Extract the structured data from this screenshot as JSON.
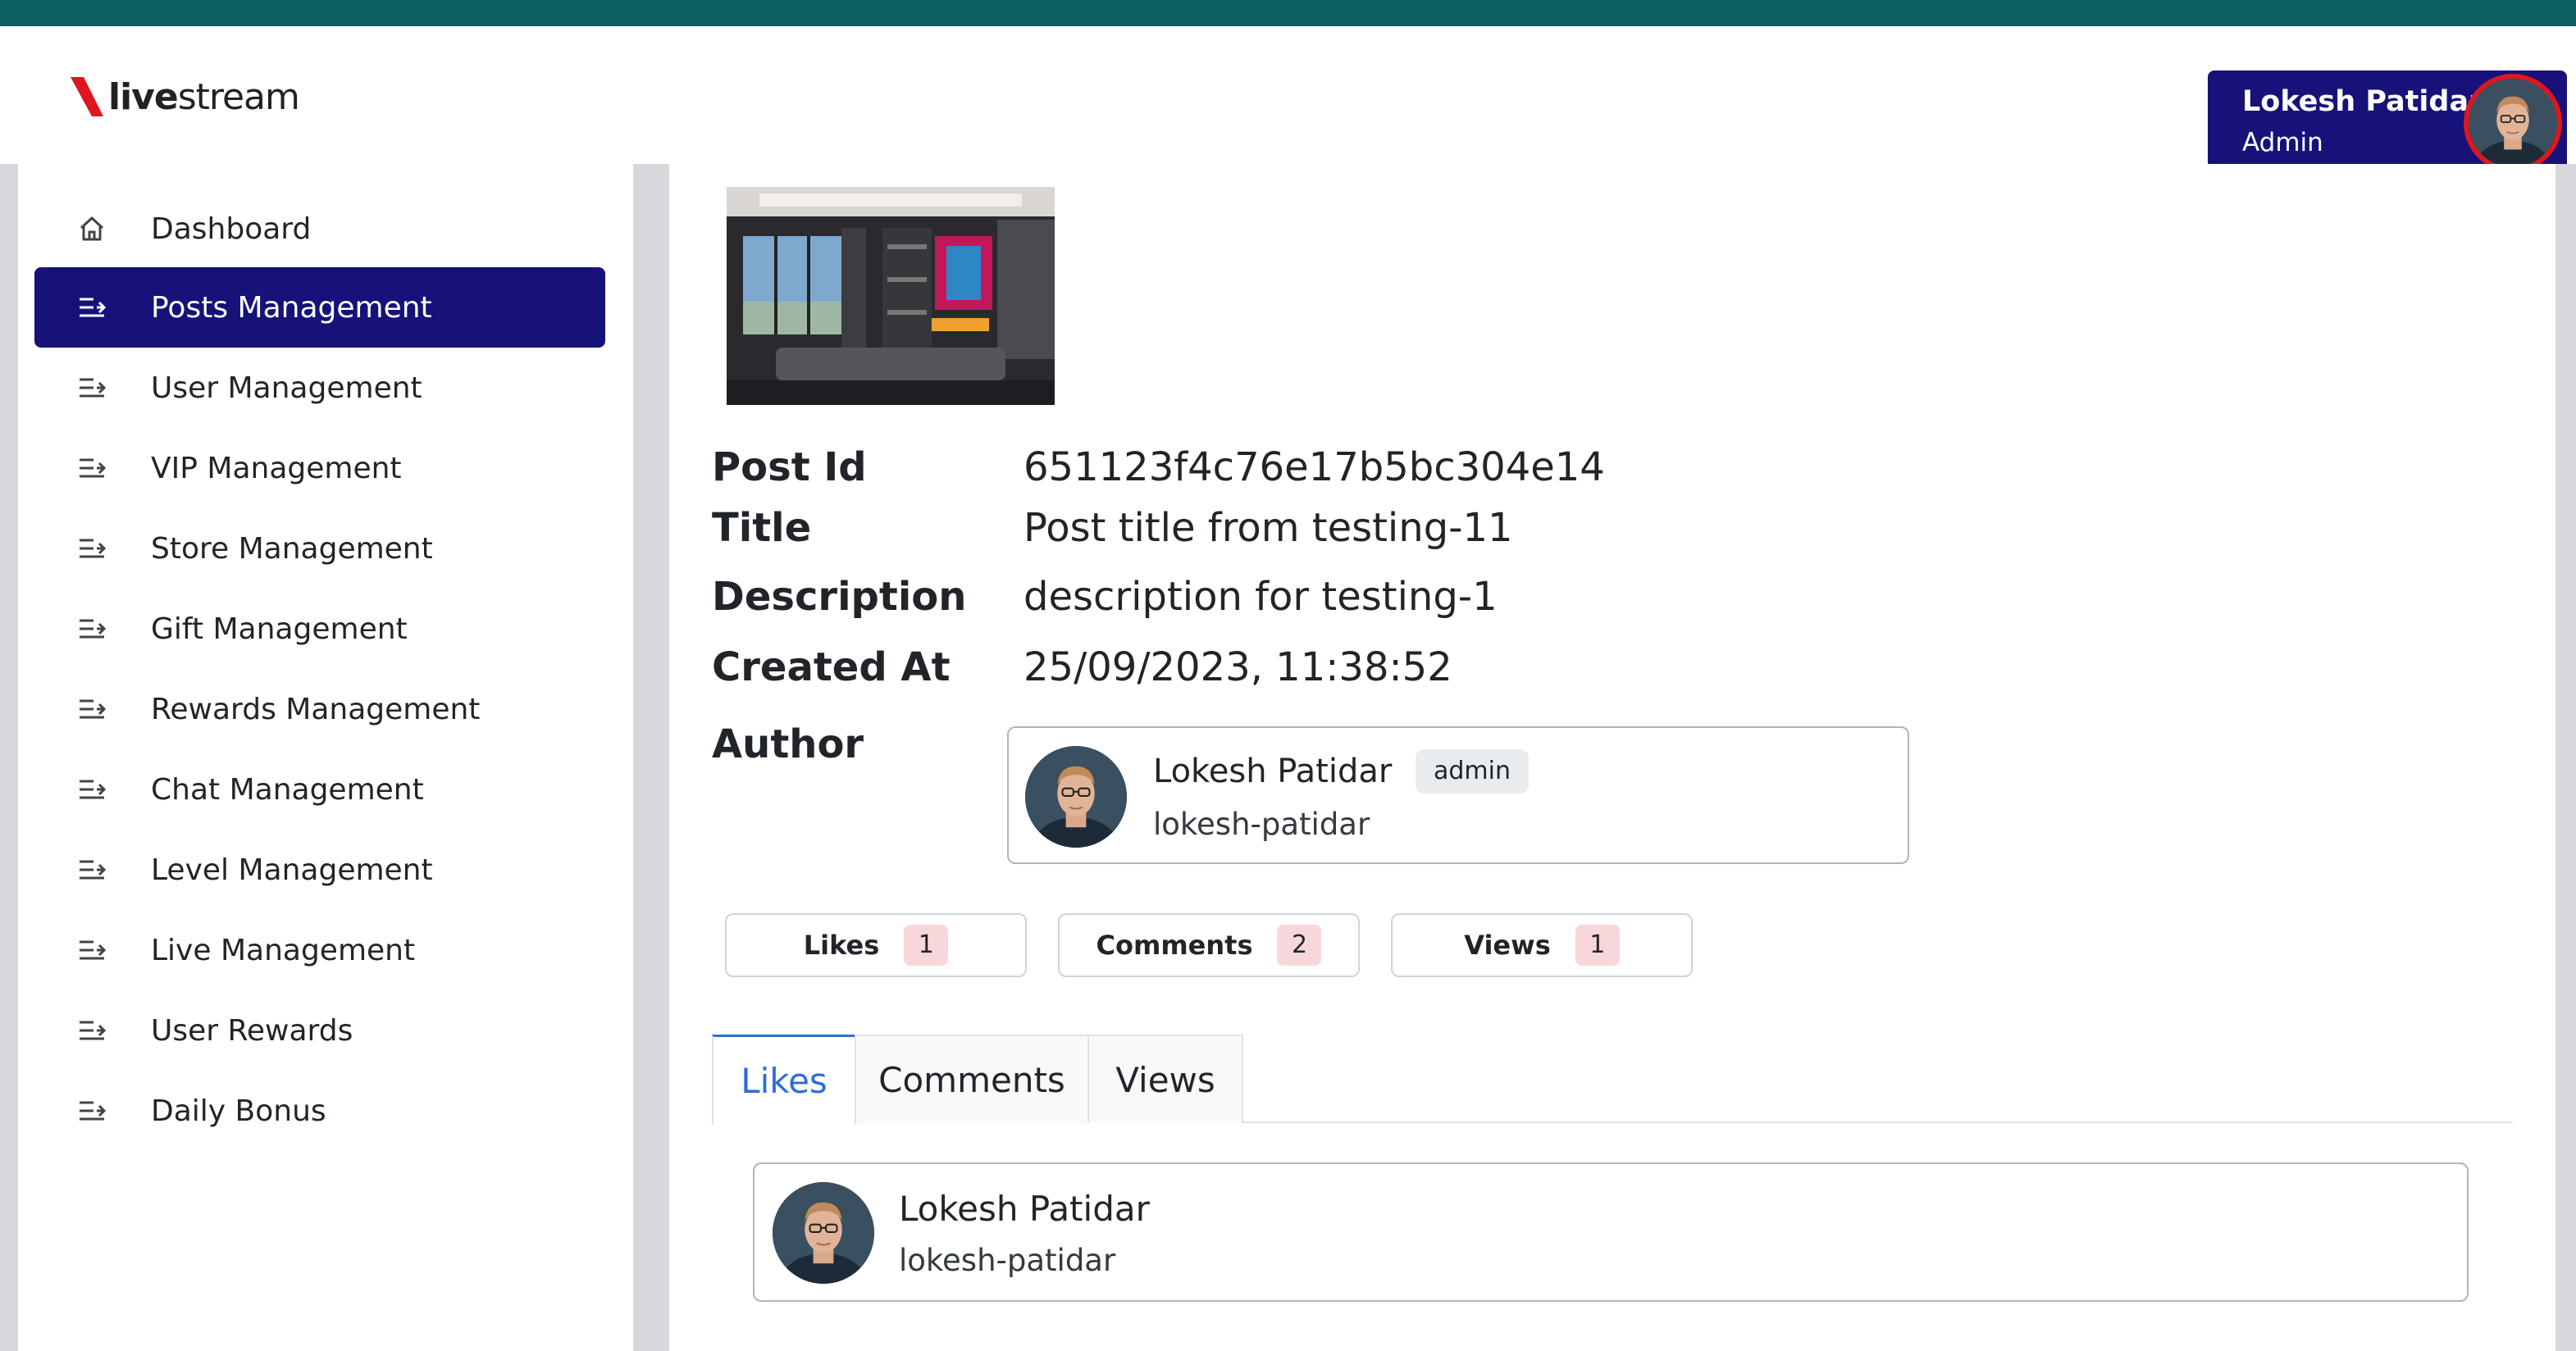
{
  "app": {
    "logo_text_bold": "live",
    "logo_text_rest": "stream",
    "brand_color": "#16127a",
    "accent_red": "#e0161f"
  },
  "user": {
    "name": "Lokesh Patidar",
    "role": "Admin"
  },
  "sidebar": {
    "items": [
      {
        "label": "Dashboard",
        "icon": "home-icon",
        "active": false
      },
      {
        "label": "Posts Management",
        "icon": "list-arrow-icon",
        "active": true
      },
      {
        "label": "User Management",
        "icon": "list-arrow-icon",
        "active": false
      },
      {
        "label": "VIP Management",
        "icon": "list-arrow-icon",
        "active": false
      },
      {
        "label": "Store Management",
        "icon": "list-arrow-icon",
        "active": false
      },
      {
        "label": "Gift Management",
        "icon": "list-arrow-icon",
        "active": false
      },
      {
        "label": "Rewards Management",
        "icon": "list-arrow-icon",
        "active": false
      },
      {
        "label": "Chat Management",
        "icon": "list-arrow-icon",
        "active": false
      },
      {
        "label": "Level Management",
        "icon": "list-arrow-icon",
        "active": false
      },
      {
        "label": "Live Management",
        "icon": "list-arrow-icon",
        "active": false
      },
      {
        "label": "User Rewards",
        "icon": "list-arrow-icon",
        "active": false
      },
      {
        "label": "Daily Bonus",
        "icon": "list-arrow-icon",
        "active": false
      }
    ]
  },
  "post": {
    "labels": {
      "id": "Post Id",
      "title": "Title",
      "description": "Description",
      "created_at": "Created At",
      "author": "Author"
    },
    "id": "651123f4c76e17b5bc304e14",
    "title": "Post title from testing-11",
    "description": "description for testing-1",
    "created_at": "25/09/2023, 11:38:52",
    "author": {
      "name": "Lokesh Patidar",
      "badge": "admin",
      "handle": "lokesh-patidar"
    }
  },
  "stats": [
    {
      "label": "Likes",
      "count": "1"
    },
    {
      "label": "Comments",
      "count": "2"
    },
    {
      "label": "Views",
      "count": "1"
    }
  ],
  "tabs": [
    {
      "label": "Likes",
      "active": true
    },
    {
      "label": "Comments",
      "active": false
    },
    {
      "label": "Views",
      "active": false
    }
  ],
  "likes_list": [
    {
      "name": "Lokesh Patidar",
      "handle": "lokesh-patidar"
    }
  ]
}
